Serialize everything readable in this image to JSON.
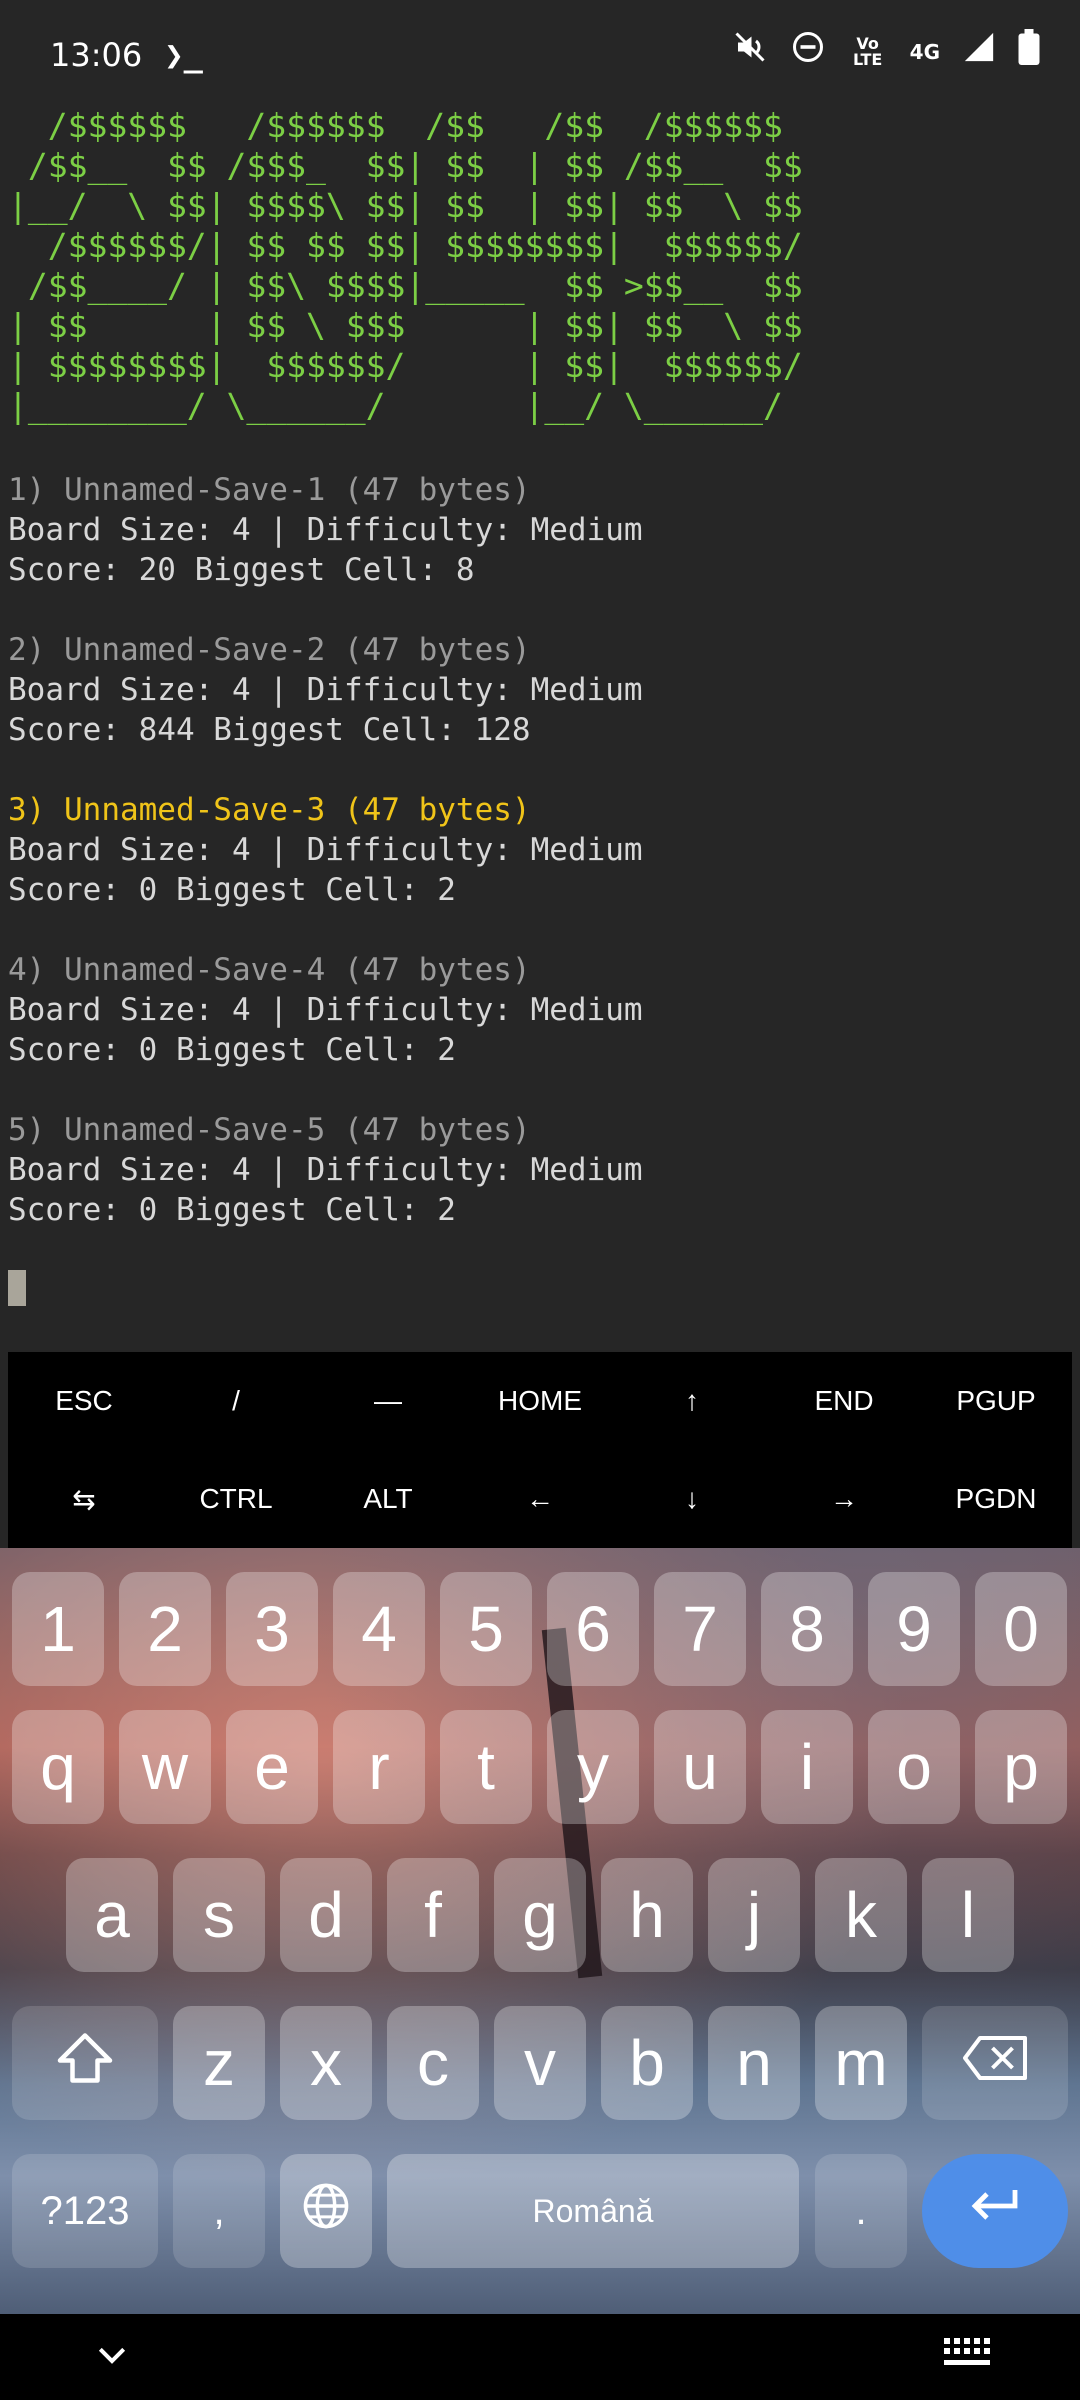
{
  "status_bar": {
    "time": "13:06",
    "terminal_glyph": "❯_",
    "mute_icon": "volume-muted",
    "dnd_icon": "do-not-disturb",
    "volte_label": "Vo LTE",
    "network_label": "4G",
    "signal_icon": "signal",
    "battery_icon": "battery"
  },
  "terminal": {
    "ascii_art": "  /$$$$$$   /$$$$$$  /$$   /$$  /$$$$$$ \n /$$__  $$ /$$$_  $$| $$  | $$ /$$__  $$\n|__/  \\ $$| $$$$\\ $$| $$  | $$| $$  \\ $$\n  /$$$$$$/| $$ $$ $$| $$$$$$$$|  $$$$$$/\n /$$____/ | $$\\ $$$$|_____  $$ >$$__  $$\n| $$      | $$ \\ $$$      | $$| $$  \\ $$\n| $$$$$$$$|  $$$$$$/      | $$|  $$$$$$/\n|________/ \\______/       |__/ \\______/ ",
    "saves": [
      {
        "title": "1) Unnamed-Save-1 (47 bytes)",
        "line1": "Board Size: 4 | Difficulty: Medium",
        "line2": "Score: 20 Biggest Cell: 8"
      },
      {
        "title": "2) Unnamed-Save-2 (47 bytes)",
        "line1": "Board Size: 4 | Difficulty: Medium",
        "line2": "Score: 844 Biggest Cell: 128"
      },
      {
        "title": "3) Unnamed-Save-3 (47 bytes)",
        "line1": "Board Size: 4 | Difficulty: Medium",
        "line2": "Score: 0 Biggest Cell: 2"
      },
      {
        "title": "4) Unnamed-Save-4 (47 bytes)",
        "line1": "Board Size: 4 | Difficulty: Medium",
        "line2": "Score: 0 Biggest Cell: 2"
      },
      {
        "title": "5) Unnamed-Save-5 (47 bytes)",
        "line1": "Board Size: 4 | Difficulty: Medium",
        "line2": "Score: 0 Biggest Cell: 2"
      }
    ]
  },
  "extra_keys": {
    "row1": [
      "ESC",
      "/",
      "—",
      "HOME",
      "↑",
      "END",
      "PGUP"
    ],
    "row2": [
      "⇆",
      "CTRL",
      "ALT",
      "←",
      "↓",
      "→",
      "PGDN"
    ]
  },
  "keyboard": {
    "numbers": [
      "1",
      "2",
      "3",
      "4",
      "5",
      "6",
      "7",
      "8",
      "9",
      "0"
    ],
    "row_q": [
      "q",
      "w",
      "e",
      "r",
      "t",
      "y",
      "u",
      "i",
      "o",
      "p"
    ],
    "row_a": [
      "a",
      "s",
      "d",
      "f",
      "g",
      "h",
      "j",
      "k",
      "l"
    ],
    "row_z": [
      "z",
      "x",
      "c",
      "v",
      "b",
      "n",
      "m"
    ],
    "shift_icon": "⇧",
    "backspace_icon": "⌫",
    "symbols_label": "?123",
    "comma": ",",
    "globe_icon": "🌐",
    "space_label": "Română",
    "period": ".",
    "enter_icon": "↵"
  },
  "nav_bar": {
    "hide_icon": "⌄"
  },
  "colors": {
    "ascii_green": "#7ccf45",
    "selected_yellow": "#f0c419",
    "dim_gray": "#9a9a9a",
    "enter_blue": "#4f8ee8"
  }
}
